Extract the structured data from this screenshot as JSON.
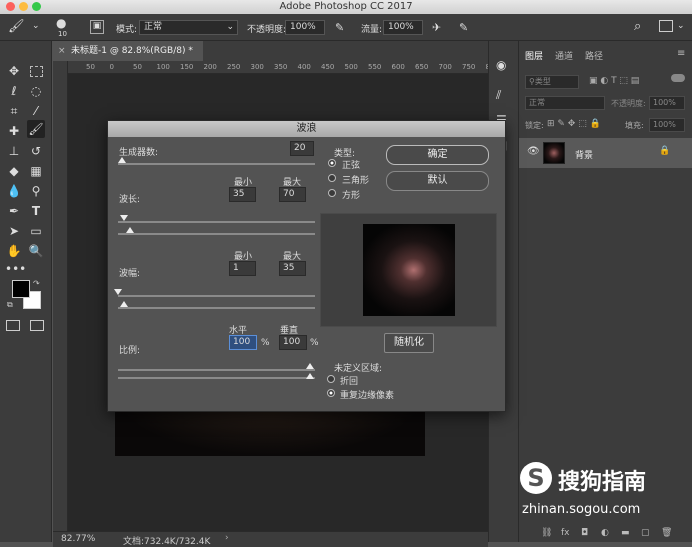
{
  "window": {
    "title": "Adobe Photoshop CC 2017"
  },
  "options": {
    "brush_size": "10",
    "mode_label": "模式:",
    "mode_value": "正常",
    "opacity_label": "不透明度:",
    "opacity_value": "100%",
    "flow_label": "流量:",
    "flow_value": "100%"
  },
  "document": {
    "tab_title": "未标题-1 @ 82.8%(RGB/8) *"
  },
  "ruler": {
    "h": [
      "50",
      "0",
      "50",
      "100",
      "150",
      "200",
      "250",
      "300",
      "350",
      "400",
      "450",
      "500",
      "550",
      "600",
      "650",
      "700",
      "750",
      "800"
    ]
  },
  "status": {
    "zoom": "82.77%",
    "doc": "文档:732.4K/732.4K"
  },
  "layers_panel": {
    "tabs": [
      "图层",
      "通道",
      "路径"
    ],
    "kind_placeholder": "类型",
    "blend": "正常",
    "opacity_label": "不透明度:",
    "opacity": "100%",
    "lock_label": "锁定:",
    "fill_label": "填充:",
    "fill": "100%",
    "layer_name": "背景"
  },
  "dialog": {
    "title": "波浪",
    "generators_label": "生成器数:",
    "generators_value": "20",
    "min_label": "最小",
    "max_label": "最大",
    "wavelength_label": "波长:",
    "wavelength_min": "35",
    "wavelength_max": "70",
    "amplitude_label": "波幅:",
    "amplitude_min": "1",
    "amplitude_max": "35",
    "scale_label": "比例:",
    "horizontal_label": "水平",
    "vertical_label": "垂直",
    "scale_h": "100",
    "scale_v": "100",
    "percent": "%",
    "type_label": "类型:",
    "type_options": [
      "正弦",
      "三角形",
      "方形"
    ],
    "ok": "确定",
    "cancel": "默认",
    "randomize": "随机化",
    "undefined_label": "未定义区域:",
    "undefined_options": [
      "折回",
      "重复边缘像素"
    ]
  },
  "watermark": {
    "brand": "搜狗指南",
    "url": "zhinan.sogou.com"
  }
}
